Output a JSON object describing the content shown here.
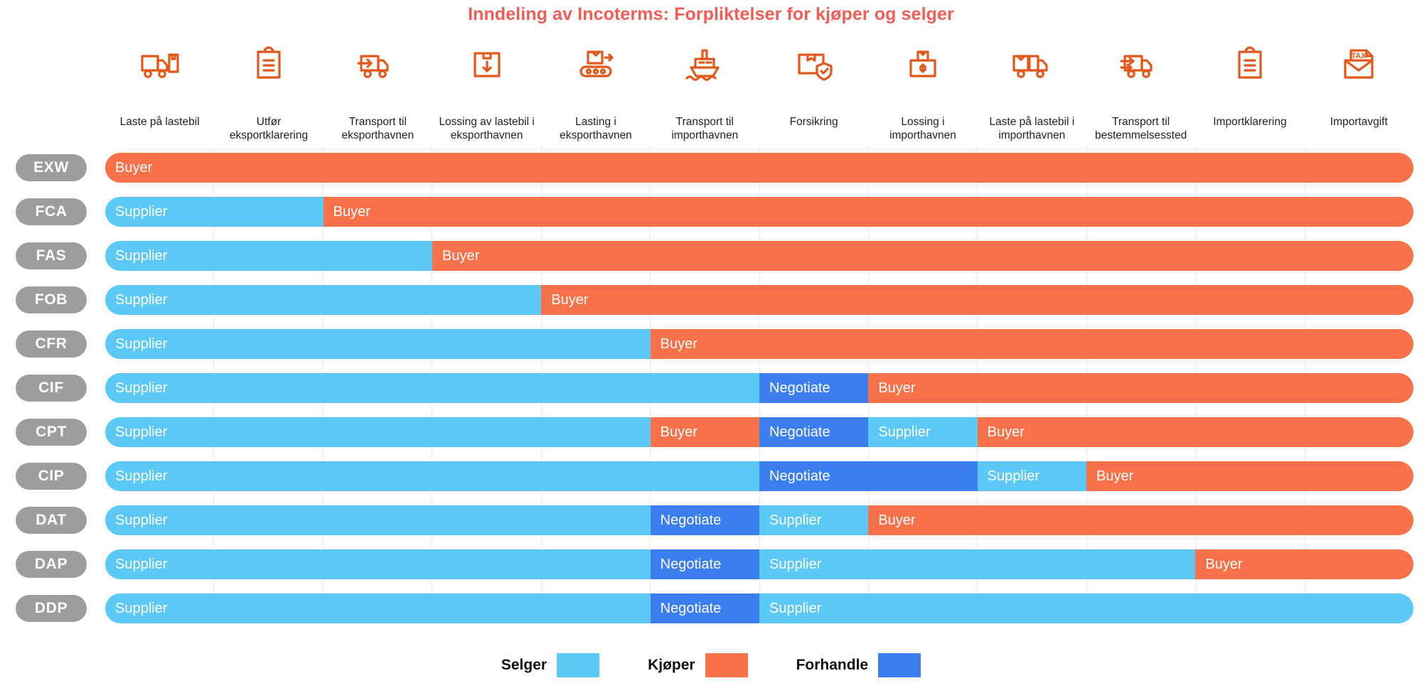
{
  "title": "Inndeling av Incoterms: Forpliktelser for kjøper og selger",
  "colors": {
    "title": "#F25C54",
    "supplier": "#5BC8F5",
    "buyer": "#F97149",
    "negotiate": "#3B7EF0",
    "pill": "#9D9D9D",
    "icon": "#E4571B",
    "gridline": "#E9EAEC"
  },
  "columns": [
    {
      "icon": "truck-load-icon",
      "label": "Laste på lastebil"
    },
    {
      "icon": "clipboard-icon",
      "label": "Utfør\neksportklarering"
    },
    {
      "icon": "truck-transport-icon",
      "label": "Transport til\neksporthavnen"
    },
    {
      "icon": "box-unload-icon",
      "label": "Lossing av lastebil i\neksporthavnen"
    },
    {
      "icon": "conveyor-load-icon",
      "label": "Lasting i\neksporthavnen"
    },
    {
      "icon": "ship-icon",
      "label": "Transport til\nimporthavnen"
    },
    {
      "icon": "box-shield-icon",
      "label": "Forsikring"
    },
    {
      "icon": "box-unloading-icon",
      "label": "Lossing i\nimporthavnen"
    },
    {
      "icon": "truck-box-load-icon",
      "label": "Laste på lastebil i\nimporthavnen"
    },
    {
      "icon": "truck-deliver-icon",
      "label": "Transport til\nbestemmelsessted"
    },
    {
      "icon": "clipboard-import-icon",
      "label": "Importklarering"
    },
    {
      "icon": "tax-envelope-icon",
      "label": "Importavgift"
    }
  ],
  "legend": [
    {
      "label": "Selger",
      "color": "#5BC8F5"
    },
    {
      "label": "Kjøper",
      "color": "#F97149"
    },
    {
      "label": "Forhandle",
      "color": "#3B7EF0"
    }
  ],
  "chart_data": {
    "type": "bar",
    "title": "Inndeling av Incoterms: Forpliktelser for kjøper og selger",
    "xlabel": "",
    "ylabel": "",
    "orientation": "horizontal-stacked",
    "grid": true,
    "legend_position": "bottom",
    "categories": [
      "Laste på lastebil",
      "Utfør eksportklarering",
      "Transport til eksporthavnen",
      "Lossing av lastebil i eksporthavnen",
      "Lasting i eksporthavnen",
      "Transport til importhavnen",
      "Forsikring",
      "Lossing i importhavnen",
      "Laste på lastebil i importhavnen",
      "Transport til bestemmelsessted",
      "Importklarering",
      "Importavgift"
    ],
    "legend_entries": [
      "Selger",
      "Kjøper",
      "Forhandle"
    ],
    "rows": [
      {
        "term": "EXW",
        "segments": [
          {
            "label": "Buyer",
            "type": "buyer",
            "span": 12
          }
        ]
      },
      {
        "term": "FCA",
        "segments": [
          {
            "label": "Supplier",
            "type": "supplier",
            "span": 2
          },
          {
            "label": "Buyer",
            "type": "buyer",
            "span": 10
          }
        ]
      },
      {
        "term": "FAS",
        "segments": [
          {
            "label": "Supplier",
            "type": "supplier",
            "span": 3
          },
          {
            "label": "Buyer",
            "type": "buyer",
            "span": 9
          }
        ]
      },
      {
        "term": "FOB",
        "segments": [
          {
            "label": "Supplier",
            "type": "supplier",
            "span": 4
          },
          {
            "label": "Buyer",
            "type": "buyer",
            "span": 8
          }
        ]
      },
      {
        "term": "CFR",
        "segments": [
          {
            "label": "Supplier",
            "type": "supplier",
            "span": 5
          },
          {
            "label": "Buyer",
            "type": "buyer",
            "span": 7
          }
        ]
      },
      {
        "term": "CIF",
        "segments": [
          {
            "label": "Supplier",
            "type": "supplier",
            "span": 6
          },
          {
            "label": "Negotiate",
            "type": "negotiate",
            "span": 1
          },
          {
            "label": "Buyer",
            "type": "buyer",
            "span": 5
          }
        ]
      },
      {
        "term": "CPT",
        "segments": [
          {
            "label": "Supplier",
            "type": "supplier",
            "span": 5
          },
          {
            "label": "Buyer",
            "type": "buyer",
            "span": 1
          },
          {
            "label": "Negotiate",
            "type": "negotiate",
            "span": 1
          },
          {
            "label": "Supplier",
            "type": "supplier",
            "span": 1
          },
          {
            "label": "Buyer",
            "type": "buyer",
            "span": 4
          }
        ]
      },
      {
        "term": "CIP",
        "segments": [
          {
            "label": "Supplier",
            "type": "supplier",
            "span": 6
          },
          {
            "label": "Negotiate",
            "type": "negotiate",
            "span": 2
          },
          {
            "label": "Supplier",
            "type": "supplier",
            "span": 1
          },
          {
            "label": "Buyer",
            "type": "buyer",
            "span": 3
          }
        ]
      },
      {
        "term": "DAT",
        "segments": [
          {
            "label": "Supplier",
            "type": "supplier",
            "span": 5
          },
          {
            "label": "Negotiate",
            "type": "negotiate",
            "span": 1
          },
          {
            "label": "Supplier",
            "type": "supplier",
            "span": 1
          },
          {
            "label": "Buyer",
            "type": "buyer",
            "span": 5
          }
        ]
      },
      {
        "term": "DAP",
        "segments": [
          {
            "label": "Supplier",
            "type": "supplier",
            "span": 5
          },
          {
            "label": "Negotiate",
            "type": "negotiate",
            "span": 1
          },
          {
            "label": "Supplier",
            "type": "supplier",
            "span": 4
          },
          {
            "label": "Buyer",
            "type": "buyer",
            "span": 2
          }
        ]
      },
      {
        "term": "DDP",
        "segments": [
          {
            "label": "Supplier",
            "type": "supplier",
            "span": 5
          },
          {
            "label": "Negotiate",
            "type": "negotiate",
            "span": 1
          },
          {
            "label": "Supplier",
            "type": "supplier",
            "span": 6
          }
        ]
      }
    ]
  }
}
